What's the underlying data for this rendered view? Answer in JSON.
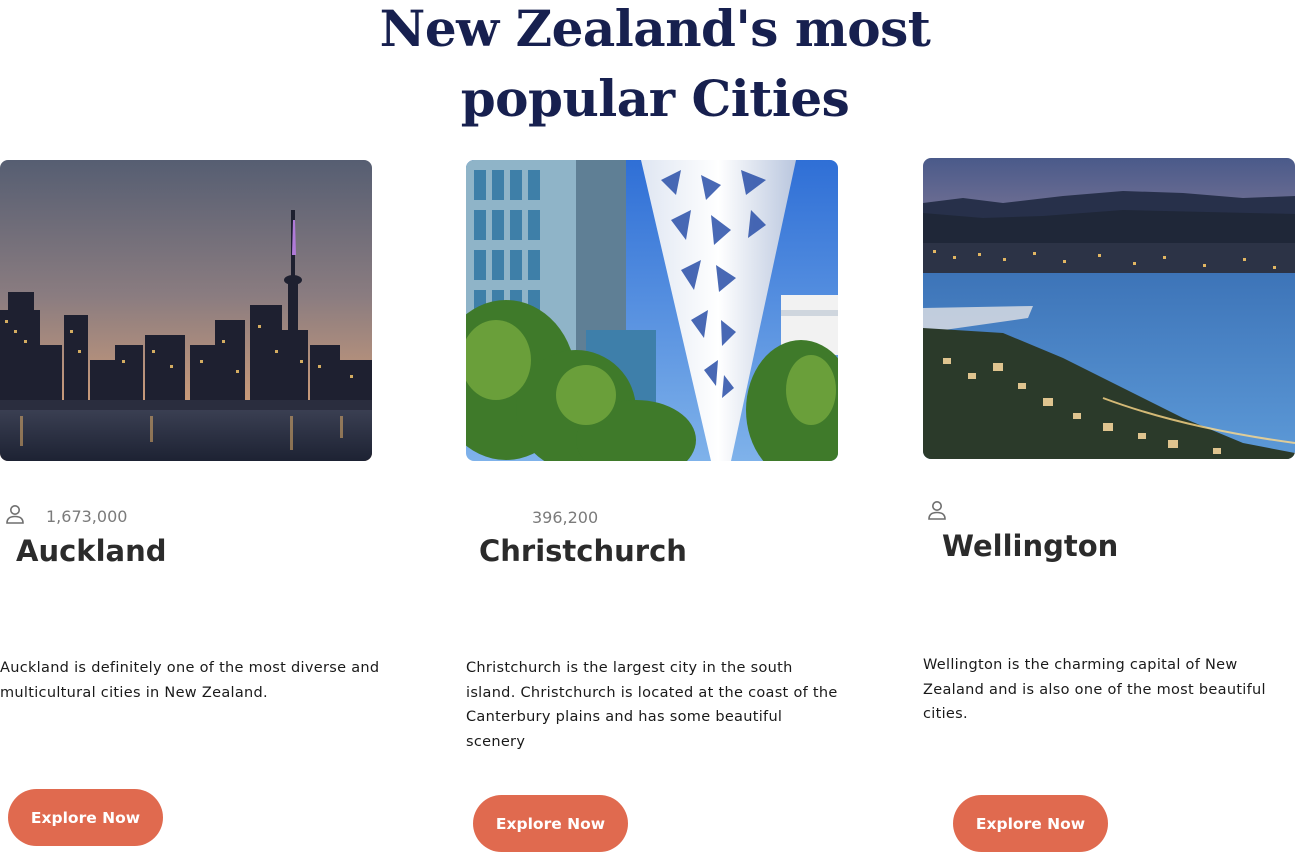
{
  "heading": {
    "line1": "New Zealand's most",
    "line2": "popular Cities"
  },
  "colors": {
    "heading": "#17204f",
    "button": "#e06a4f",
    "button_text": "#ffffff",
    "city_name": "#2b2b2b",
    "population": "#7b7b7b"
  },
  "cities": [
    {
      "name": "Auckland",
      "population": "1,673,000",
      "description": "Auckland is definitely one of the most diverse and multicultural cities in New Zealand.",
      "button_label": "Explore Now",
      "image_icon": "auckland-skyline-photo",
      "population_icon": "person-icon"
    },
    {
      "name": "Christchurch",
      "population": "396,200",
      "description": "Christchurch is the largest city in the south island. Christchurch is located at the coast of the Canterbury plains and has some beautiful scenery",
      "button_label": "Explore Now",
      "image_icon": "christchurch-sculpture-photo"
    },
    {
      "name": "Wellington",
      "population": "",
      "description": "Wellington is the charming capital of New Zealand and is also one of the most beautiful cities.",
      "button_label": "Explore Now",
      "image_icon": "wellington-harbour-photo",
      "population_icon": "person-icon"
    }
  ]
}
